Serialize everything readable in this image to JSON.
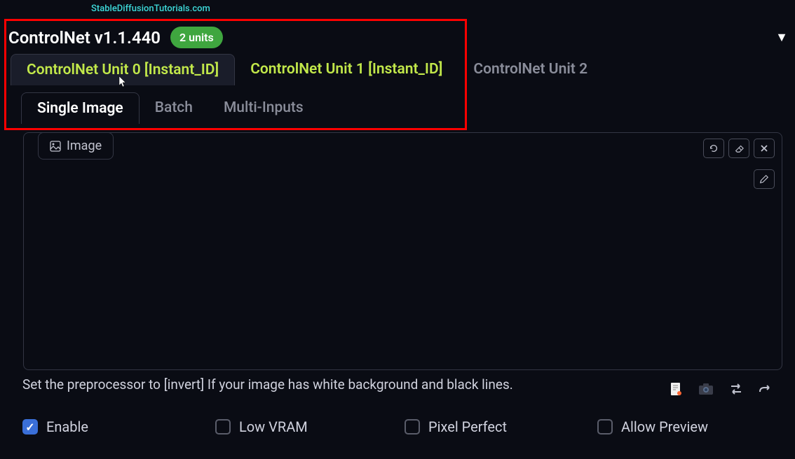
{
  "watermark": "StableDiffusionTutorials.com",
  "header": {
    "title": "ControlNet v1.1.440",
    "badge": "2 units"
  },
  "unit_tabs": [
    {
      "label": "ControlNet Unit 0 [Instant_ID]",
      "state": "active"
    },
    {
      "label": "ControlNet Unit 1 [Instant_ID]",
      "state": "highlighted"
    },
    {
      "label": "ControlNet Unit 2",
      "state": "inactive"
    }
  ],
  "mode_tabs": [
    {
      "label": "Single Image",
      "state": "active"
    },
    {
      "label": "Batch",
      "state": "inactive"
    },
    {
      "label": "Multi-Inputs",
      "state": "inactive"
    }
  ],
  "image_tab_label": "Image",
  "hint_text": "Set the preprocessor to [invert] If your image has white background and black lines.",
  "checkboxes": [
    {
      "label": "Enable",
      "checked": true
    },
    {
      "label": "Low VRAM",
      "checked": false
    },
    {
      "label": "Pixel Perfect",
      "checked": false
    },
    {
      "label": "Allow Preview",
      "checked": false
    }
  ]
}
